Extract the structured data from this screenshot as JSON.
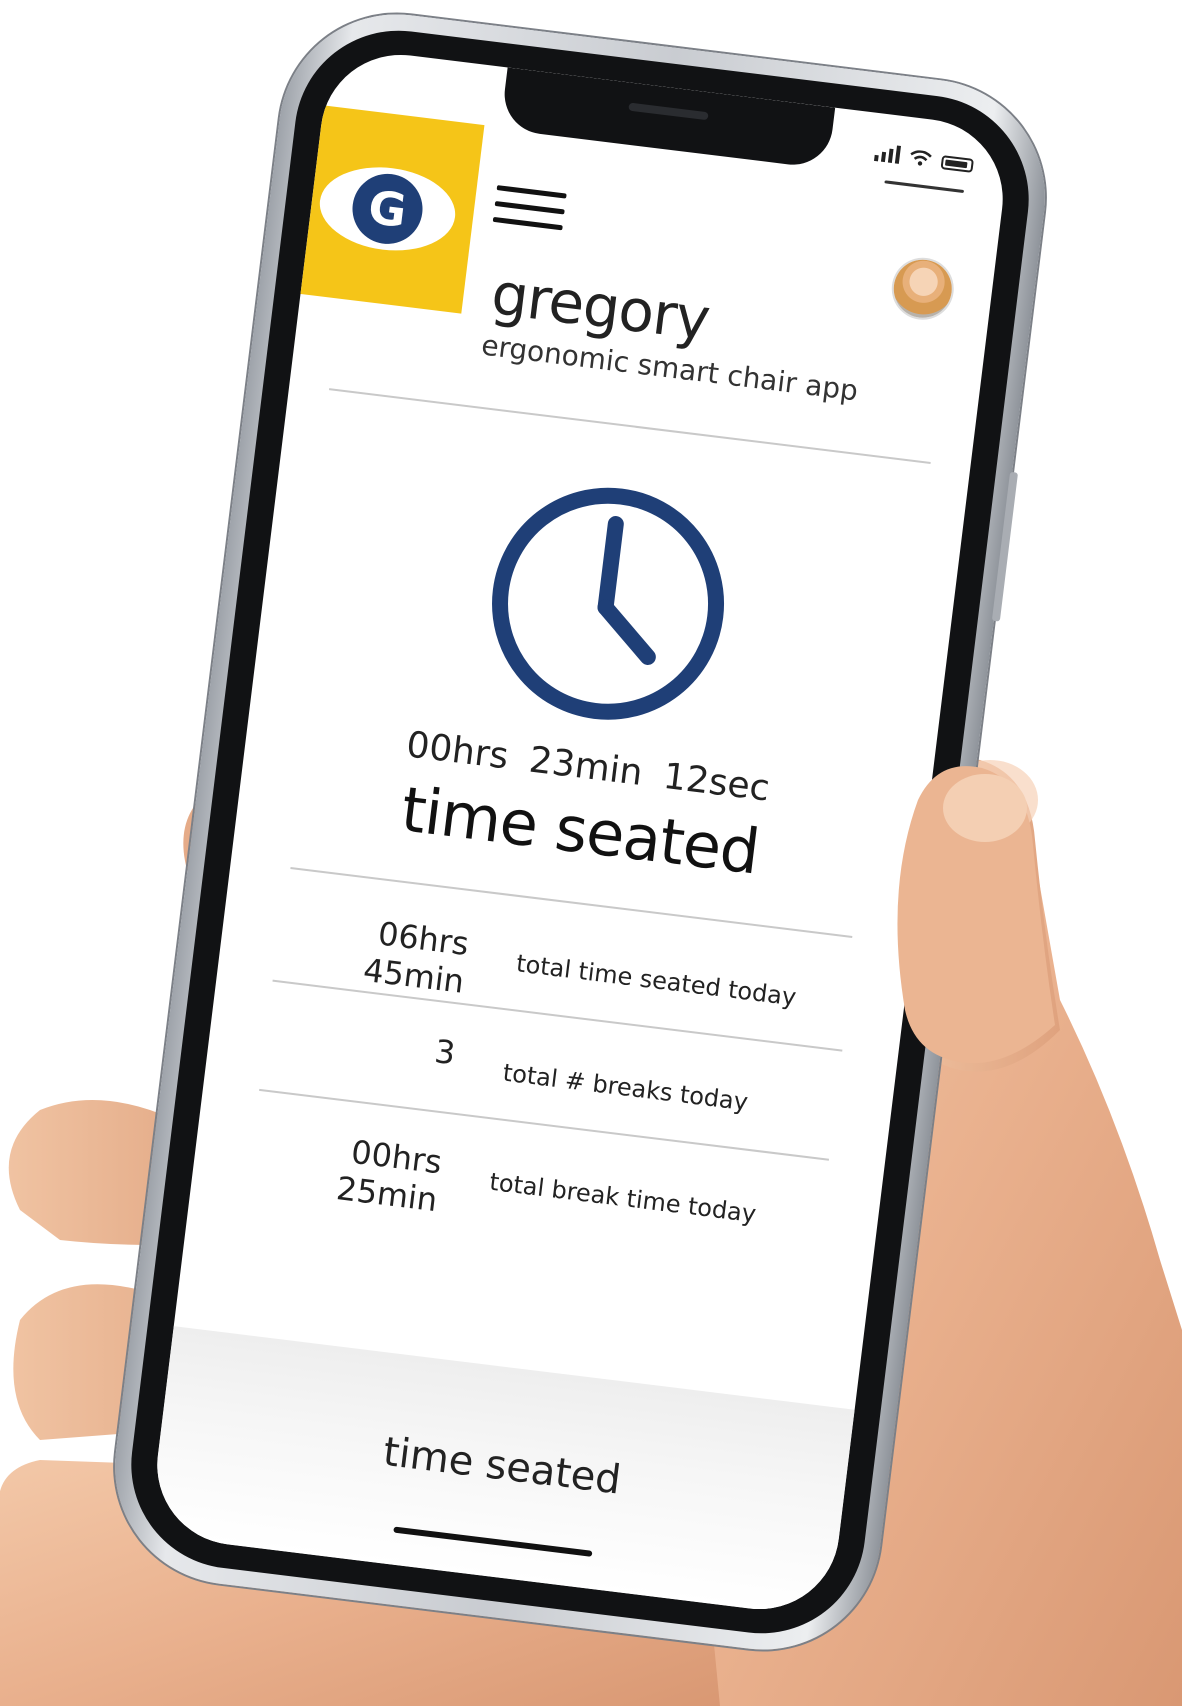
{
  "app": {
    "name": "gregory",
    "subtitle": "ergonomic smart chair app",
    "logo_letter": "G"
  },
  "colors": {
    "brand_yellow": "#f5c518",
    "brand_navy": "#1f3f77",
    "text": "#222222"
  },
  "icons": {
    "menu": "hamburger-menu-icon",
    "clock": "clock-icon",
    "signal": "signal-icon",
    "wifi": "wifi-icon",
    "battery": "battery-icon",
    "avatar": "user-avatar"
  },
  "timer": {
    "value": "00hrs  23min  12sec",
    "label": "time seated"
  },
  "stats": [
    {
      "value": "06hrs  45min",
      "label": "total time seated today"
    },
    {
      "value": "3",
      "label": "total # breaks today"
    },
    {
      "value": "00hrs  25min",
      "label": "total break time today"
    }
  ],
  "bottom_tab": {
    "label": "time seated"
  }
}
